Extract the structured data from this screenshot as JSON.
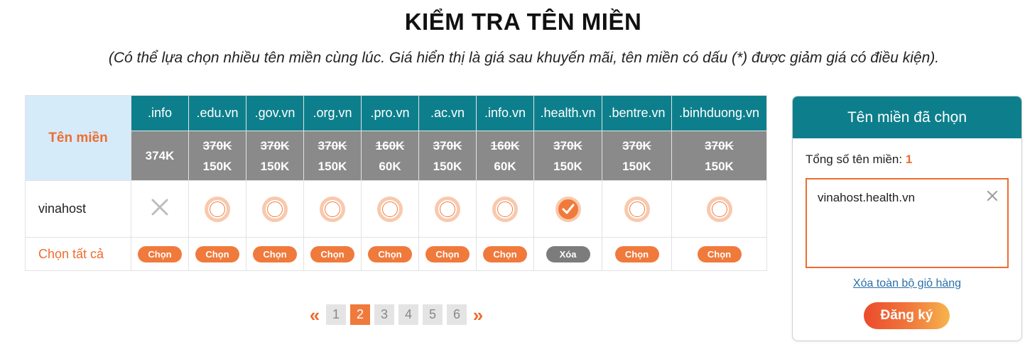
{
  "header": {
    "title": "KIỂM TRA TÊN MIỀN",
    "subtitle": "(Có thể lựa chọn nhiều tên miền cùng lúc. Giá hiển thị là giá sau khuyến mãi, tên miền có dấu (*) được giảm giá có điều kiện)."
  },
  "table": {
    "corner_label": "Tên miền",
    "extensions": [
      {
        "ext": ".info",
        "old_price": "",
        "price": "374K"
      },
      {
        "ext": ".edu.vn",
        "old_price": "370K",
        "price": "150K"
      },
      {
        "ext": ".gov.vn",
        "old_price": "370K",
        "price": "150K"
      },
      {
        "ext": ".org.vn",
        "old_price": "370K",
        "price": "150K"
      },
      {
        "ext": ".pro.vn",
        "old_price": "160K",
        "price": "60K"
      },
      {
        "ext": ".ac.vn",
        "old_price": "370K",
        "price": "150K"
      },
      {
        "ext": ".info.vn",
        "old_price": "160K",
        "price": "60K"
      },
      {
        "ext": ".health.vn",
        "old_price": "370K",
        "price": "150K"
      },
      {
        "ext": ".bentre.vn",
        "old_price": "370K",
        "price": "150K"
      },
      {
        "ext": ".binhduong.vn",
        "old_price": "370K",
        "price": "150K"
      }
    ],
    "row_name": "vinahost",
    "row_status": [
      "unavailable",
      "available",
      "available",
      "available",
      "available",
      "available",
      "available",
      "selected",
      "available",
      "available"
    ],
    "select_all_label": "Chọn tất cả",
    "button_labels": [
      "Chọn",
      "Chọn",
      "Chọn",
      "Chọn",
      "Chọn",
      "Chọn",
      "Chọn",
      "Xóa",
      "Chọn",
      "Chọn"
    ]
  },
  "pagination": {
    "prev_symbol": "«",
    "next_symbol": "»",
    "pages": [
      "1",
      "2",
      "3",
      "4",
      "5",
      "6"
    ],
    "current": "2"
  },
  "cart": {
    "title": "Tên miền đã chọn",
    "count_label": "Tổng số tên miền:",
    "count": "1",
    "items": [
      "vinahost.health.vn"
    ],
    "clear_label": "Xóa toàn bộ giỏ hàng",
    "register_label": "Đăng ký"
  },
  "colors": {
    "teal": "#0d7f8c",
    "orange": "#f07a3c",
    "price_gray": "#8a8a8a",
    "corner_blue": "#d5ebfa"
  },
  "icons": {
    "unavailable": "x-mark-icon",
    "available": "radio-circle-icon",
    "selected": "checkmark-circle-icon",
    "remove": "close-icon"
  }
}
